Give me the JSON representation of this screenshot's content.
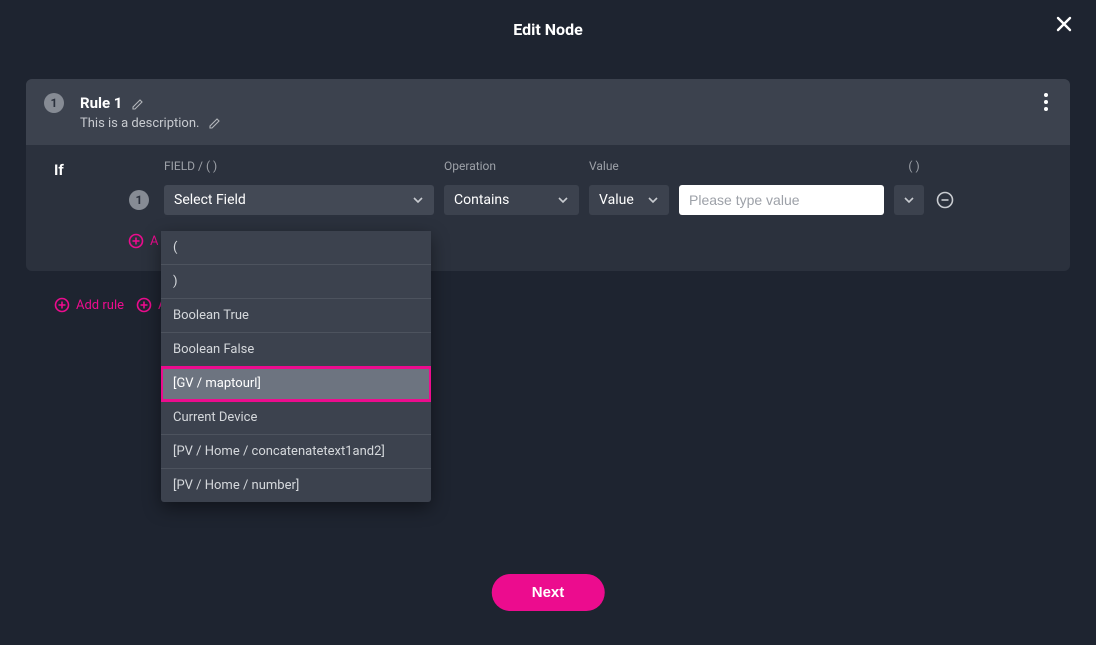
{
  "modal": {
    "title": "Edit Node"
  },
  "rule": {
    "badge": "1",
    "title": "Rule 1",
    "description": "This is a description."
  },
  "ifLabel": "If",
  "headers": {
    "field": "FIELD / ( )",
    "operation": "Operation",
    "value": "Value",
    "paren": "( )"
  },
  "row": {
    "badge": "1",
    "fieldPlaceholder": "Select Field",
    "operation": "Contains",
    "valueSelect": "Value",
    "valueInputPlaceholder": "Please type value"
  },
  "dropdown": {
    "items": [
      "(",
      ")",
      "Boolean True",
      "Boolean False",
      "[GV / maptourl]",
      "Current Device",
      "[PV / Home / concatenatetext1and2]",
      "[PV / Home / number]"
    ],
    "highlightIndex": 4
  },
  "actions": {
    "addRule": "Add rule",
    "addRuleGroup": "Add rule group",
    "addCondition": "Add condition"
  },
  "next": "Next"
}
